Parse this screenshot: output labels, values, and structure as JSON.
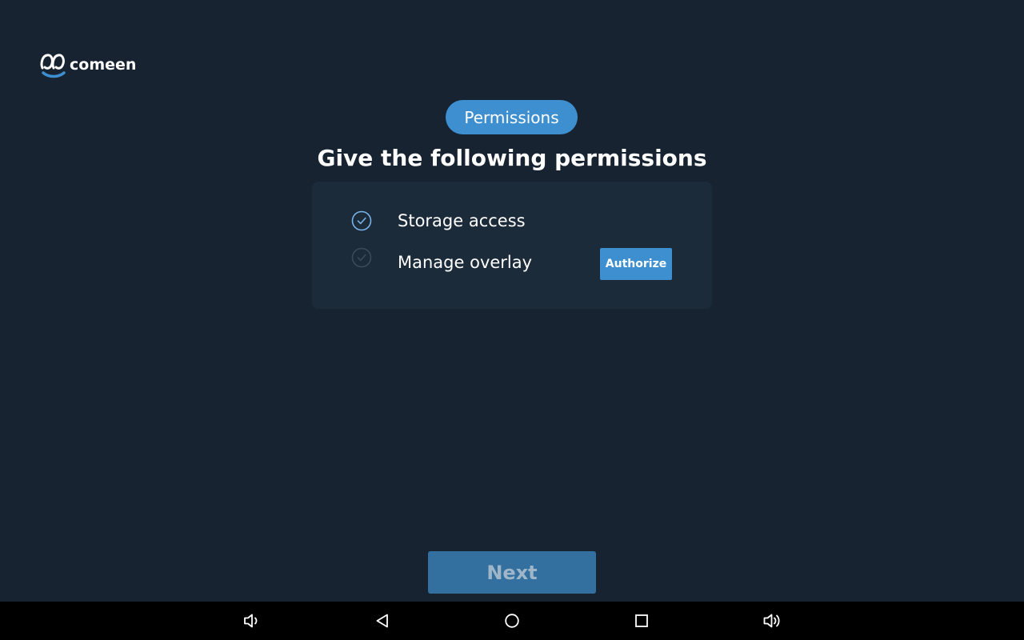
{
  "app": {
    "logo_text": "comeen",
    "badge": "Permissions",
    "title": "Give the following permissions"
  },
  "permissions": [
    {
      "label": "Storage access",
      "granted": true
    },
    {
      "label": "Manage overlay",
      "granted": false,
      "action_label": "Authorize"
    }
  ],
  "footer": {
    "next_label": "Next"
  },
  "navbar": {
    "icons": [
      "volume-down-icon",
      "back-icon",
      "home-icon",
      "recents-icon",
      "volume-up-icon"
    ]
  },
  "colors": {
    "background": "#172330",
    "card": "#1c2b3a",
    "accent": "#3e8fd0",
    "next_button": "#33709f",
    "check_granted": "#7ab3e6",
    "check_pending": "#3c4a58"
  }
}
